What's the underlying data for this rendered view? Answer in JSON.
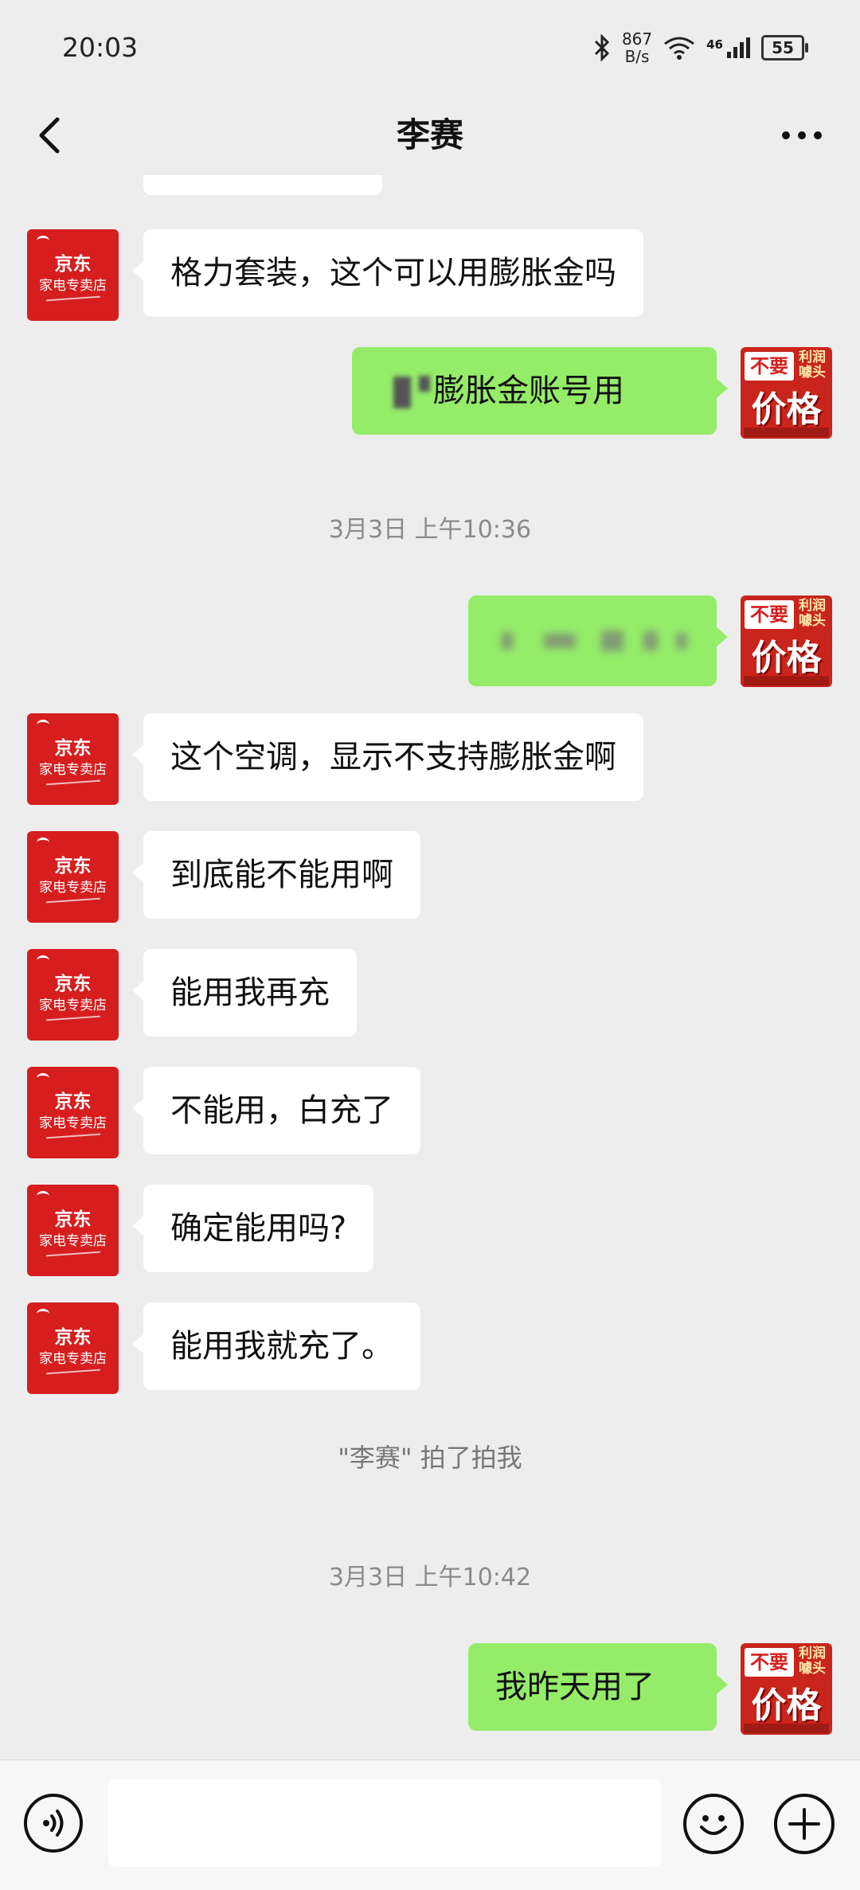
{
  "status_bar": {
    "time": "20:03",
    "net_speed_value": "867",
    "net_speed_unit": "B/s",
    "signal_label": "46",
    "battery": "55"
  },
  "header": {
    "title": "李赛"
  },
  "messages": [
    {
      "side": "in",
      "text": "格力套装，这个可以用膨胀金吗"
    },
    {
      "side": "out",
      "text": "膨胀金账号用"
    },
    {
      "timestamp": "3月3日 上午10:36"
    },
    {
      "side": "out",
      "text": ""
    },
    {
      "side": "in",
      "text": "这个空调，显示不支持膨胀金啊"
    },
    {
      "side": "in",
      "text": "到底能不能用啊"
    },
    {
      "side": "in",
      "text": "能用我再充"
    },
    {
      "side": "in",
      "text": "不能用，白充了"
    },
    {
      "side": "in",
      "text": "确定能用吗?"
    },
    {
      "side": "in",
      "text": "能用我就充了。"
    },
    {
      "system": "\"李赛\" 拍了拍我"
    },
    {
      "timestamp": "3月3日 上午10:42"
    },
    {
      "side": "out",
      "text": "我昨天用了"
    }
  ],
  "avatars": {
    "contact_line1": "京东",
    "contact_line2": "家电专卖店",
    "me_tag": "不要",
    "me_corner": "利润 噱头",
    "me_main": "价格"
  },
  "colors": {
    "background": "#ededed",
    "bubble_in": "#ffffff",
    "bubble_out": "#95ec69",
    "avatar_red": "#d61e1e"
  },
  "icons": {
    "back": "chevron-left-icon",
    "more": "more-dots-icon",
    "voice": "voice-icon",
    "emoji": "emoji-icon",
    "plus": "plus-icon"
  }
}
